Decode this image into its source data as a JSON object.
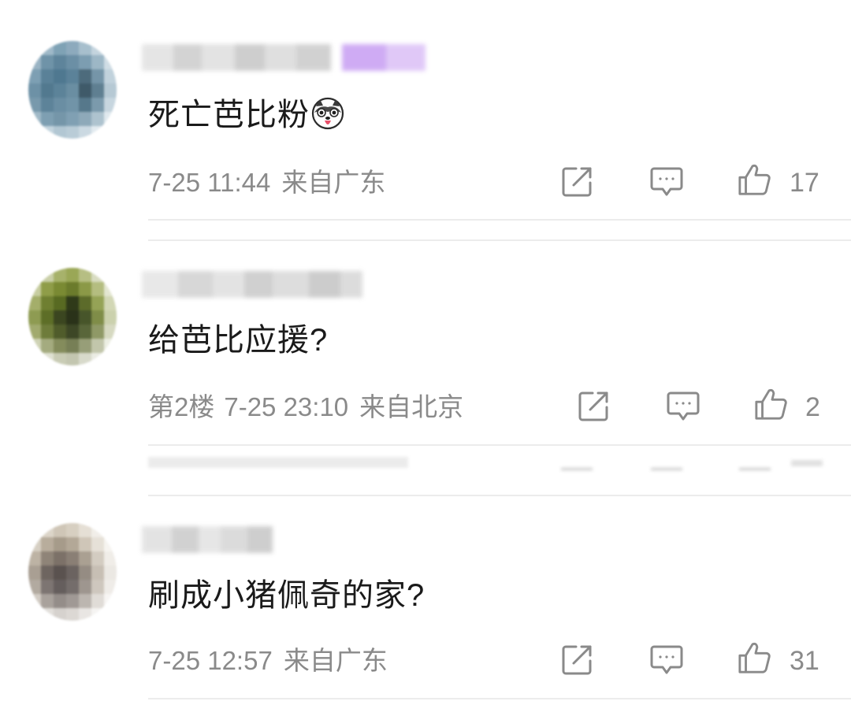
{
  "comments": [
    {
      "text": "死亡芭比粉",
      "emoji_icon": "husky-dog-emoji",
      "floor": "",
      "timestamp": "7-25 11:44",
      "location": "来自广东",
      "likes": "17"
    },
    {
      "text": "给芭比应援?",
      "emoji_icon": "",
      "floor": "第2楼",
      "timestamp": "7-25 23:10",
      "location": "来自北京",
      "likes": "2"
    },
    {
      "text": "刷成小猪佩奇的家?",
      "emoji_icon": "",
      "floor": "",
      "timestamp": "7-25 12:57",
      "location": "来自广东",
      "likes": "31"
    }
  ],
  "icons": {
    "share": "share-icon",
    "reply": "comment-icon",
    "like": "thumbs-up-icon"
  },
  "colors": {
    "text": "#1a1a1a",
    "meta": "#8a8a8a",
    "divider": "#ececec",
    "username_tag": "#c9a2f2"
  }
}
